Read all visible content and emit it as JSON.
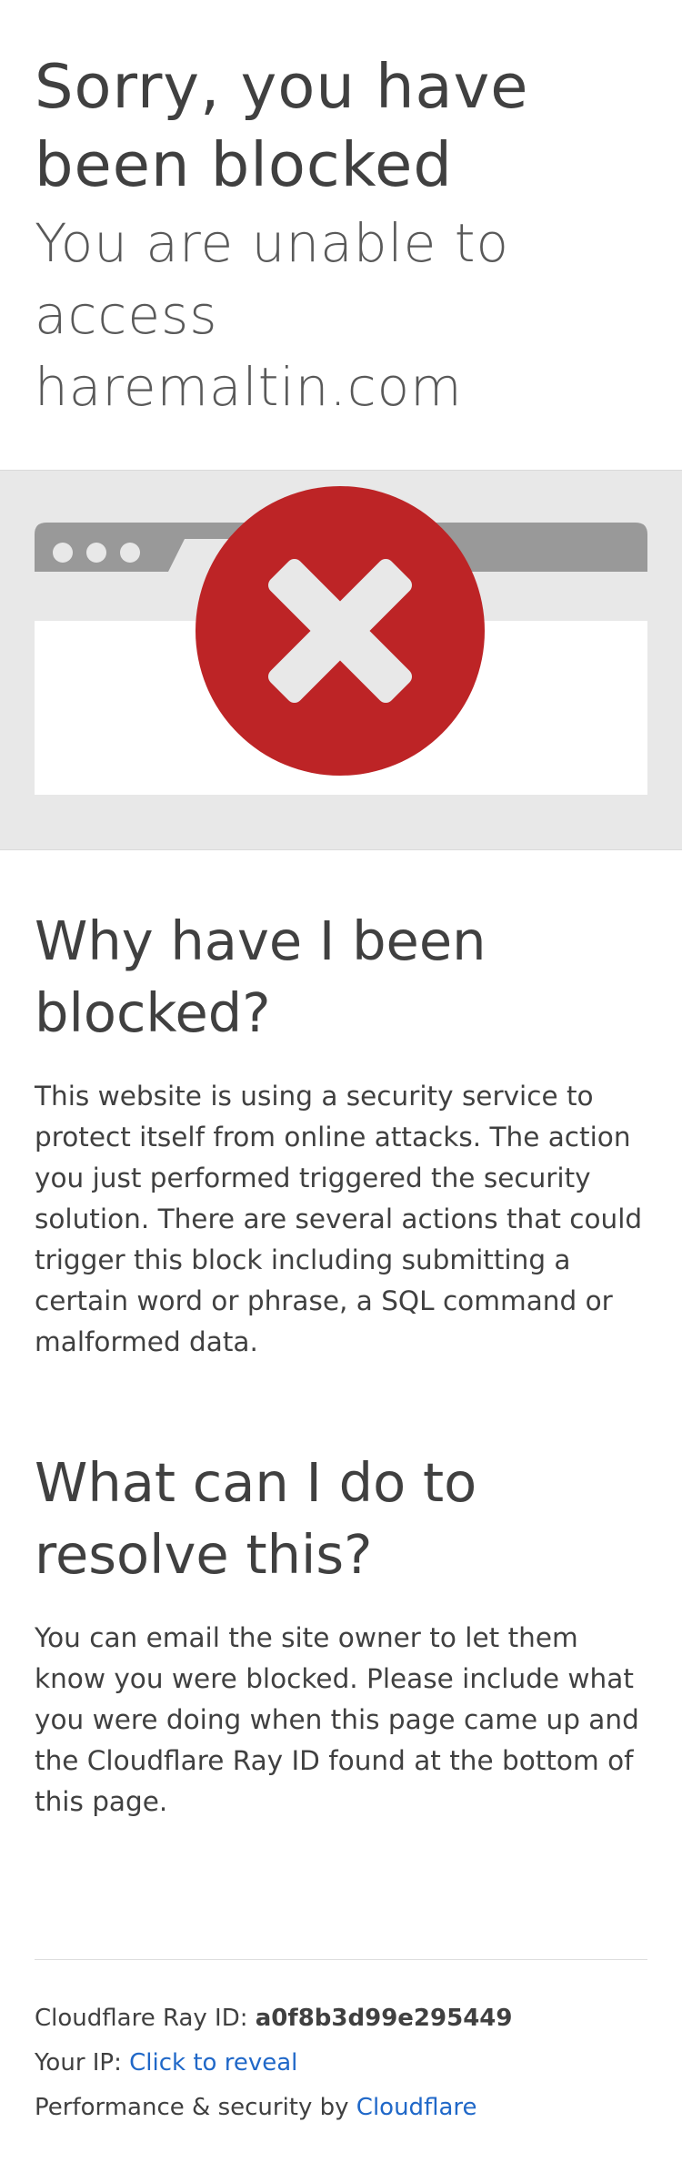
{
  "header": {
    "title": "Sorry, you have been blocked",
    "subtitle": "You are unable to access haremaltin.com"
  },
  "illustration": {
    "icon": "browser-window-with-error-x-icon",
    "colors": {
      "band_bg": "#e8e8e8",
      "window_bar": "#999999",
      "window_body": "#ffffff",
      "error_circle": "#bd2426",
      "cross": "#e8e8e8"
    }
  },
  "why": {
    "title": "Why have I been blocked?",
    "text": "This website is using a security service to protect itself from online attacks. The action you just performed triggered the security solution. There are several actions that could trigger this block including submitting a certain word or phrase, a SQL command or malformed data."
  },
  "resolve": {
    "title": "What can I do to resolve this?",
    "text": "You can email the site owner to let them know you were blocked. Please include what you were doing when this page came up and the Cloudflare Ray ID found at the bottom of this page."
  },
  "footer": {
    "ray_label": "Cloudflare Ray ID:",
    "ray_id": "a0f8b3d99e295449",
    "ip_label": "Your IP:",
    "ip_link": "Click to reveal",
    "perf_label": "Performance & security by",
    "perf_link": "Cloudflare",
    "link_color": "#2068c8"
  }
}
